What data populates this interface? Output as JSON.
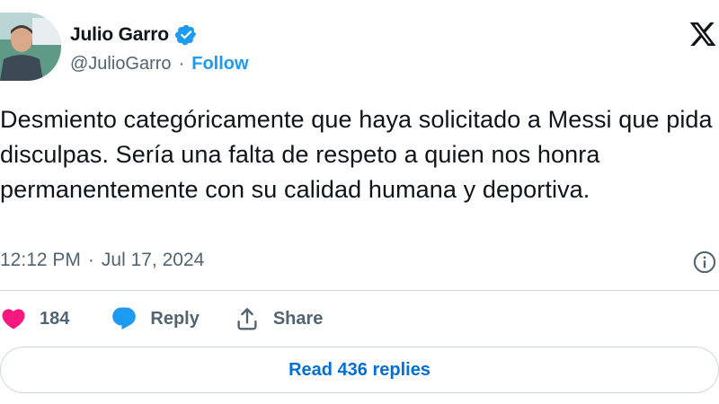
{
  "author": {
    "display_name": "Julio Garro",
    "handle": "@JulioGarro",
    "separator": "·",
    "follow_label": "Follow",
    "verified_color": "#1d9bf0"
  },
  "tweet": {
    "text": "Desmiento categóricamente que haya solicitado a Messi que pida disculpas. Sería una falta de respeto a quien nos honra permanentemente con su calidad humana y deportiva.",
    "time": "12:12 PM",
    "separator": "·",
    "date": "Jul 17, 2024"
  },
  "actions": {
    "like_count": "184",
    "reply_label": "Reply",
    "share_label": "Share",
    "like_color": "#f91880",
    "reply_color": "#1d9bf0"
  },
  "read_replies_label": "Read 436 replies",
  "icons": [
    "verified-badge-icon",
    "x-logo-icon",
    "info-icon",
    "heart-icon",
    "speech-bubble-icon",
    "share-icon"
  ]
}
